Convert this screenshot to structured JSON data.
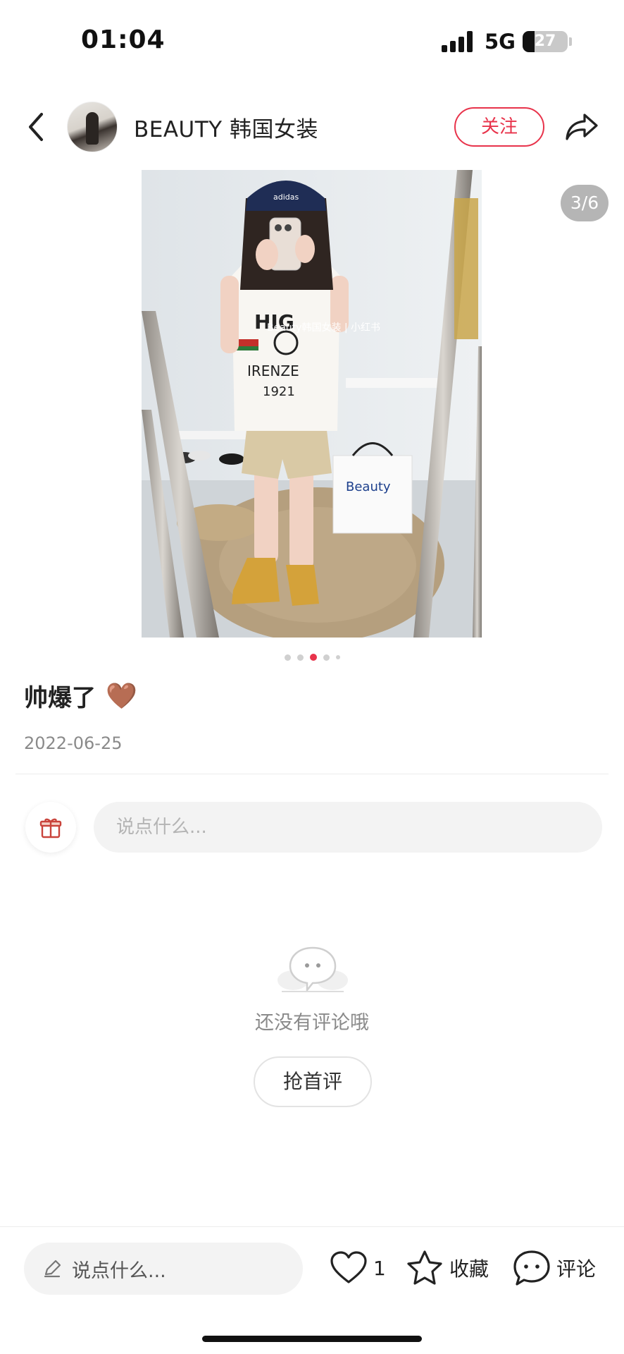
{
  "status_bar": {
    "time": "01:04",
    "network": "5G",
    "battery": "27",
    "battery_level": 0.27
  },
  "header": {
    "back_icon": "chevron-left-icon",
    "shop_name": "BEAUTY 韩国女装",
    "follow_label": "关注",
    "share_icon": "share-arrow-icon"
  },
  "photo": {
    "counter": "3/6",
    "watermark": "Beauty韩国女装 | 小红书",
    "bag_text": "Beauty",
    "dots": {
      "count": 5,
      "active_index": 2
    }
  },
  "post": {
    "title": "帅爆了",
    "emoji": "🤎",
    "date": "2022-06-25"
  },
  "comment_box": {
    "gift_icon": "gift-icon",
    "placeholder": "说点什么..."
  },
  "empty_state": {
    "icon": "chat-bubble-icon",
    "text": "还没有评论哦",
    "button_label": "抢首评"
  },
  "bottom_bar": {
    "input_icon": "pencil-icon",
    "input_placeholder": "说点什么...",
    "like_count": "1",
    "collect_label": "收藏",
    "comment_label": "评论"
  },
  "colors": {
    "accent": "#e8334b",
    "text_primary": "#222222",
    "text_secondary": "#8a8a8a",
    "input_bg": "#f3f3f3"
  }
}
